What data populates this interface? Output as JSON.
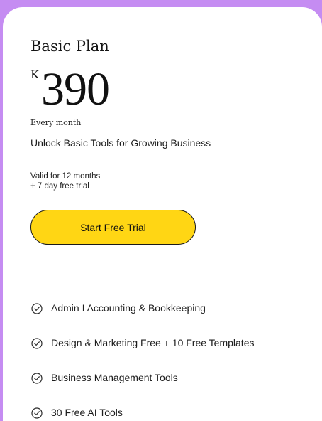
{
  "plan": {
    "name": "Basic Plan",
    "currency": "K",
    "price": "390",
    "period": "Every month",
    "tagline": "Unlock Basic Tools for Growing Business",
    "validity_line1": "Valid for 12 months",
    "validity_line2": "+ 7 day free trial",
    "cta_label": "Start Free Trial"
  },
  "features": [
    {
      "label": "Admin I Accounting & Bookkeeping",
      "icon": "check-circle-icon"
    },
    {
      "label": "Design & Marketing Free + 10 Free Templates",
      "icon": "check-circle-icon"
    },
    {
      "label": "Business Management Tools",
      "icon": "check-circle-icon"
    },
    {
      "label": "30 Free AI Tools",
      "icon": "check-circle-icon"
    }
  ],
  "colors": {
    "background": "#c58cf2",
    "card": "#ffffff",
    "cta": "#ffd614",
    "text": "#1a1a1a"
  }
}
